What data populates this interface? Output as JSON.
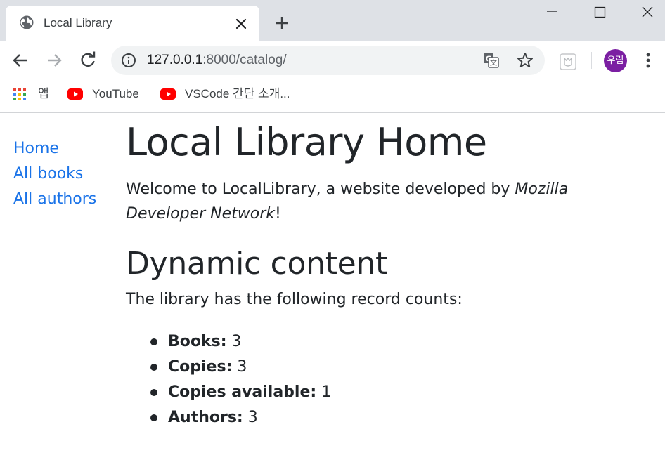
{
  "browser": {
    "tab": {
      "title": "Local Library"
    },
    "omnibox": {
      "host": "127.0.0.1",
      "rest": ":8000/catalog/"
    },
    "avatar_label": "우림",
    "bookmarks": [
      {
        "label": "앱",
        "icon": "apps-grid-icon"
      },
      {
        "label": "YouTube",
        "icon": "youtube-icon"
      },
      {
        "label": "VSCode 간단 소개...",
        "icon": "youtube-icon"
      }
    ]
  },
  "sidebar": {
    "items": [
      {
        "label": "Home"
      },
      {
        "label": "All books"
      },
      {
        "label": "All authors"
      }
    ]
  },
  "main": {
    "title": "Local Library Home",
    "welcome_prefix": "Welcome to LocalLibrary, a website developed by ",
    "welcome_emphasis": "Mozilla Developer Network",
    "welcome_suffix": "!",
    "section_title": "Dynamic content",
    "counts_intro": "The library has the following record counts:",
    "counts": [
      {
        "label": "Books:",
        "value": "3"
      },
      {
        "label": "Copies:",
        "value": "3"
      },
      {
        "label": "Copies available:",
        "value": "1"
      },
      {
        "label": "Authors:",
        "value": "3"
      }
    ]
  },
  "colors": {
    "link": "#1a73e8",
    "text": "#212529",
    "avatar": "#7b1fa2",
    "youtube": "#ff0000",
    "chrome_frame": "#dee1e6"
  }
}
